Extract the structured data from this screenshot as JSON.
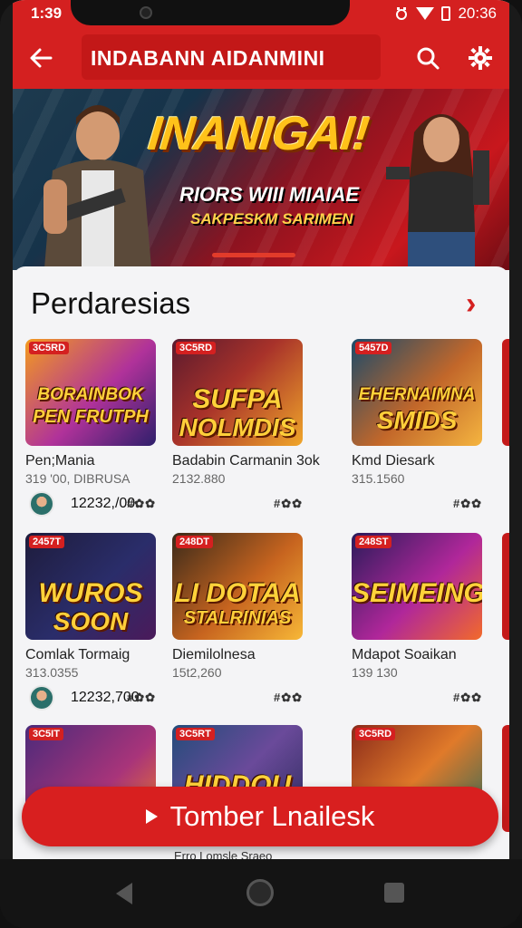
{
  "status": {
    "time": "1:39",
    "clock": "20:36"
  },
  "appbar": {
    "title": "INDABANN AIDANMINI"
  },
  "banner": {
    "title": "INANIGAI!",
    "subtitle": "RIORS WIII MIAIAE",
    "tagline": "SAKPESKM SARIMEN"
  },
  "section": {
    "title": "Perdaresias",
    "more": "›"
  },
  "games": [
    {
      "tag": "3C5RD",
      "art": "BORAINBOK",
      "art2": "PEN FRUTPH",
      "name": "Pen;Mania",
      "num": "319 '00, DIBRUSA",
      "count": "12232,/00",
      "icons": "#✿✿",
      "has_meta": true
    },
    {
      "tag": "3C5RD",
      "art": "SUFPA",
      "art2": "NOLMDIS",
      "name": "Badabin Carmanin 3ok",
      "num": "2132.880",
      "icons": "#✿✿",
      "has_meta": true
    },
    {
      "tag": "5457D",
      "art": "EHERNAIMNA",
      "art2": "SMIDS",
      "name": "Kmd Diesark",
      "num": "315.1560",
      "icons": "#✿✿",
      "has_meta": true
    },
    {
      "tag": "2457T",
      "art": "WUROS",
      "art2": "SOON",
      "name": "Comlak Tormaig",
      "num": "313.0355",
      "count": "12232,700",
      "icons": "#✿✿",
      "has_meta": true
    },
    {
      "tag": "248DT",
      "art": "LI DOTAA",
      "art2": "STALRINIAS",
      "name": "Diemilolnesa",
      "num": "15t2,260",
      "icons": "#✿✿",
      "has_meta": true
    },
    {
      "tag": "248ST",
      "art": "SEIMEING",
      "art2": "",
      "name": "Mdapot Soaikan",
      "num": "139 130",
      "icons": "#✿✿",
      "has_meta": true
    },
    {
      "tag": "3C5IT",
      "art": "",
      "art2": "",
      "name": "",
      "num": ""
    },
    {
      "tag": "3C5RT",
      "art": "HIDDOU",
      "art2": "",
      "name": "",
      "num": ""
    },
    {
      "tag": "3C5RD",
      "art": "",
      "art2": "",
      "name": "",
      "num": ""
    }
  ],
  "cta": {
    "label": "Tomber Lnailesk"
  },
  "peek": "Erro Lomsle Sraeo",
  "colors": {
    "brand": "#d42020",
    "brand_dark": "#c31818",
    "accent": "#ffc21a"
  }
}
